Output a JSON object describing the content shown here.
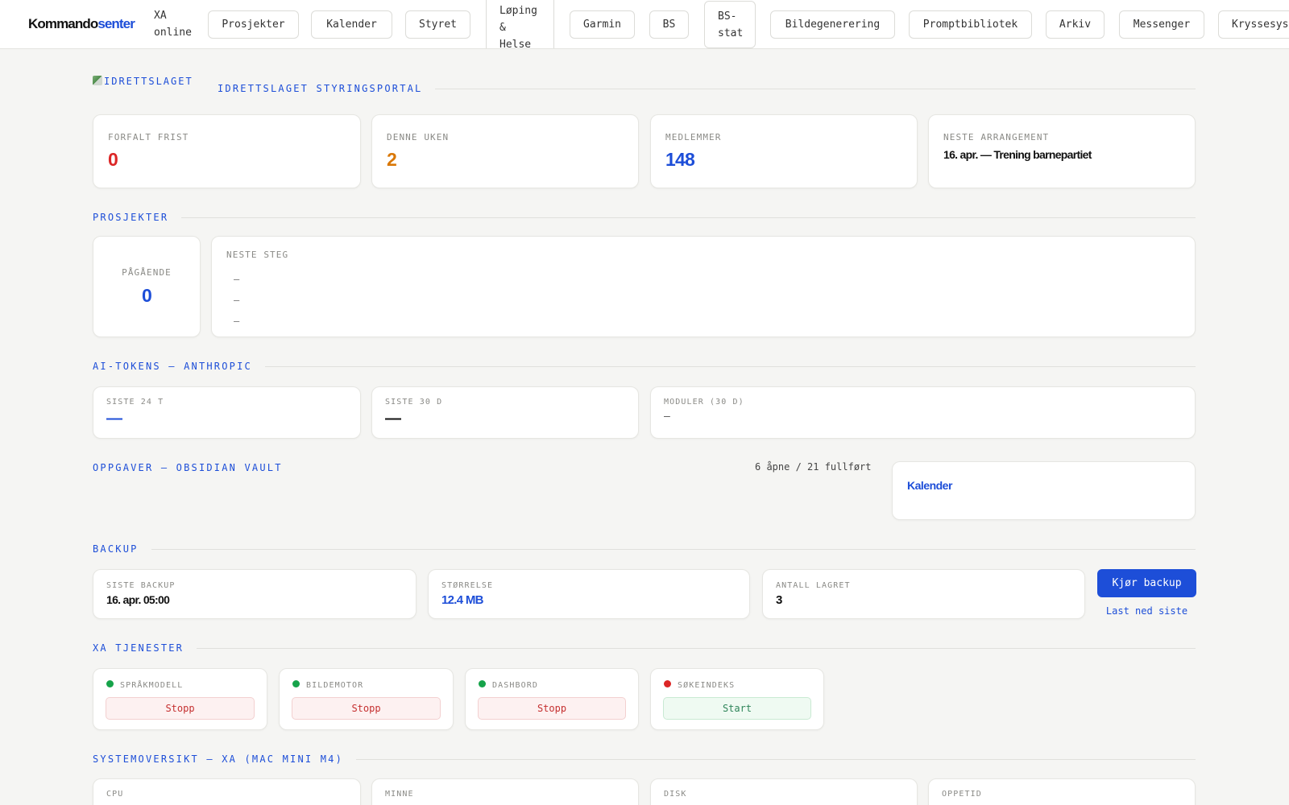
{
  "brand": {
    "part1": "Kommando",
    "part2": "senter"
  },
  "status": {
    "line1": "XA",
    "line2": "online"
  },
  "nav": [
    {
      "label": "Prosjekter"
    },
    {
      "label": "Kalender"
    },
    {
      "label": "Styret"
    },
    {
      "lines": [
        "Løping",
        "&",
        "Helse"
      ]
    },
    {
      "label": "Garmin"
    },
    {
      "label": "BS"
    },
    {
      "lines": [
        "BS-",
        "stat"
      ]
    },
    {
      "label": "Bildegenerering"
    },
    {
      "label": "Promptbibliotek"
    },
    {
      "label": "Arkiv"
    },
    {
      "label": "Messenger"
    },
    {
      "label": "Kryssesys"
    }
  ],
  "portal": {
    "logo_alt": "IDRETTSLAGET",
    "title": "IDRETTSLAGET STYRINGSPORTAL"
  },
  "stats": [
    {
      "label": "FORFALT FRIST",
      "value": "0",
      "color": "#dc2626"
    },
    {
      "label": "DENNE UKEN",
      "value": "2",
      "color": "#d97706"
    },
    {
      "label": "MEDLEMMER",
      "value": "148",
      "color": "#1d4ed8"
    },
    {
      "label": "NESTE ARRANGEMENT",
      "value": "16. apr. — Trening barnepartiet"
    }
  ],
  "projects": {
    "heading": "PROSJEKTER",
    "ongoing_label": "PÅGÅENDE",
    "ongoing_value": "0",
    "next_label": "NESTE STEG",
    "next_items": [
      "—",
      "—",
      "—"
    ]
  },
  "ai_tokens": {
    "heading": "AI-TOKENS — ANTHROPIC",
    "cards": [
      {
        "label": "SISTE 24 T",
        "value": "—"
      },
      {
        "label": "SISTE 30 D",
        "value": "—"
      },
      {
        "label": "MODULER (30 D)",
        "value": "—"
      }
    ]
  },
  "tasks": {
    "heading": "OPPGAVER — OBSIDIAN VAULT",
    "summary": "6 åpne / 21 fullført",
    "calendar_link": "Kalender"
  },
  "backup": {
    "heading": "BACKUP",
    "cards": [
      {
        "label": "SISTE BACKUP",
        "value": "16. apr. 05:00"
      },
      {
        "label": "STØRRELSE",
        "value": "12.4 MB"
      },
      {
        "label": "ANTALL LAGRET",
        "value": "3"
      }
    ],
    "run_button": "Kjør backup",
    "download_link": "Last ned siste"
  },
  "services": {
    "heading": "XA TJENESTER",
    "items": [
      {
        "name": "SPRÅKMODELL",
        "status": "running",
        "status_color": "#16a34a",
        "action": "Stopp"
      },
      {
        "name": "BILDEMOTOR",
        "status": "running",
        "status_color": "#16a34a",
        "action": "Stopp"
      },
      {
        "name": "DASHBORD",
        "status": "running",
        "status_color": "#16a34a",
        "action": "Stopp"
      },
      {
        "name": "SØKEINDEKS",
        "status": "stopped",
        "status_color": "#dc2626",
        "action": "Start"
      }
    ]
  },
  "system": {
    "heading": "SYSTEMOVERSIKT — XA (MAC MINI M4)",
    "cards": [
      {
        "label": "CPU"
      },
      {
        "label": "MINNE"
      },
      {
        "label": "DISK"
      },
      {
        "label": "OPPETID"
      }
    ]
  },
  "colors": {
    "accent": "#1d4ed8",
    "danger": "#dc2626",
    "warning": "#d97706",
    "success": "#16a34a"
  }
}
